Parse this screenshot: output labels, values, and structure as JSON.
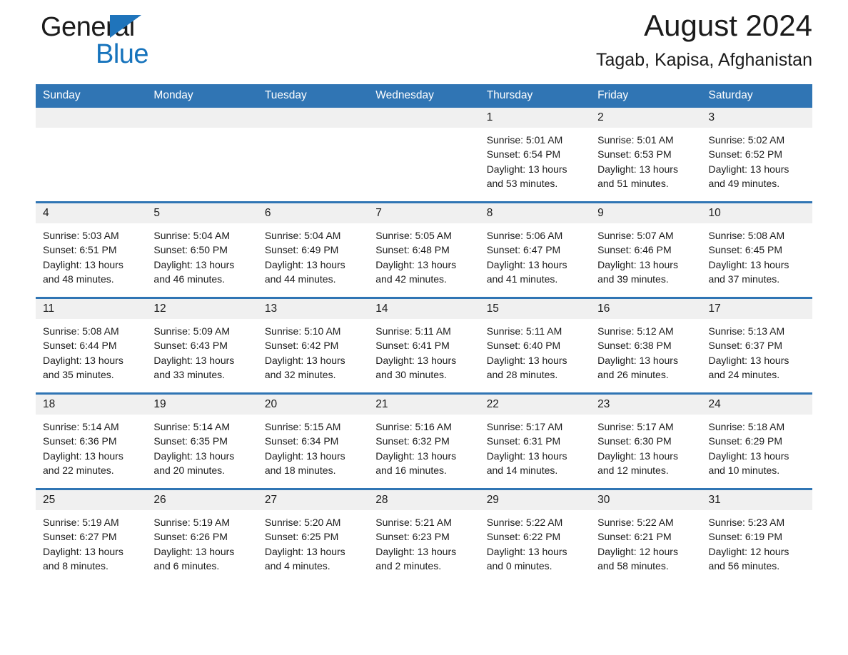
{
  "brand": {
    "name_part1": "General",
    "name_part2": "Blue",
    "triangle_color": "#1f74bb",
    "blue_color": "#1673bc"
  },
  "header": {
    "month_title": "August 2024",
    "location": "Tagab, Kapisa, Afghanistan",
    "accent_color": "#3075b4",
    "daynum_background": "#f0f0f0"
  },
  "weekday_headers": [
    "Sunday",
    "Monday",
    "Tuesday",
    "Wednesday",
    "Thursday",
    "Friday",
    "Saturday"
  ],
  "weeks": [
    [
      {
        "day": "",
        "sunrise": "",
        "sunset": "",
        "daylight": "",
        "empty": true
      },
      {
        "day": "",
        "sunrise": "",
        "sunset": "",
        "daylight": "",
        "empty": true
      },
      {
        "day": "",
        "sunrise": "",
        "sunset": "",
        "daylight": "",
        "empty": true
      },
      {
        "day": "",
        "sunrise": "",
        "sunset": "",
        "daylight": "",
        "empty": true
      },
      {
        "day": "1",
        "sunrise": "Sunrise: 5:01 AM",
        "sunset": "Sunset: 6:54 PM",
        "daylight": "Daylight: 13 hours and 53 minutes.",
        "empty": false
      },
      {
        "day": "2",
        "sunrise": "Sunrise: 5:01 AM",
        "sunset": "Sunset: 6:53 PM",
        "daylight": "Daylight: 13 hours and 51 minutes.",
        "empty": false
      },
      {
        "day": "3",
        "sunrise": "Sunrise: 5:02 AM",
        "sunset": "Sunset: 6:52 PM",
        "daylight": "Daylight: 13 hours and 49 minutes.",
        "empty": false
      }
    ],
    [
      {
        "day": "4",
        "sunrise": "Sunrise: 5:03 AM",
        "sunset": "Sunset: 6:51 PM",
        "daylight": "Daylight: 13 hours and 48 minutes.",
        "empty": false
      },
      {
        "day": "5",
        "sunrise": "Sunrise: 5:04 AM",
        "sunset": "Sunset: 6:50 PM",
        "daylight": "Daylight: 13 hours and 46 minutes.",
        "empty": false
      },
      {
        "day": "6",
        "sunrise": "Sunrise: 5:04 AM",
        "sunset": "Sunset: 6:49 PM",
        "daylight": "Daylight: 13 hours and 44 minutes.",
        "empty": false
      },
      {
        "day": "7",
        "sunrise": "Sunrise: 5:05 AM",
        "sunset": "Sunset: 6:48 PM",
        "daylight": "Daylight: 13 hours and 42 minutes.",
        "empty": false
      },
      {
        "day": "8",
        "sunrise": "Sunrise: 5:06 AM",
        "sunset": "Sunset: 6:47 PM",
        "daylight": "Daylight: 13 hours and 41 minutes.",
        "empty": false
      },
      {
        "day": "9",
        "sunrise": "Sunrise: 5:07 AM",
        "sunset": "Sunset: 6:46 PM",
        "daylight": "Daylight: 13 hours and 39 minutes.",
        "empty": false
      },
      {
        "day": "10",
        "sunrise": "Sunrise: 5:08 AM",
        "sunset": "Sunset: 6:45 PM",
        "daylight": "Daylight: 13 hours and 37 minutes.",
        "empty": false
      }
    ],
    [
      {
        "day": "11",
        "sunrise": "Sunrise: 5:08 AM",
        "sunset": "Sunset: 6:44 PM",
        "daylight": "Daylight: 13 hours and 35 minutes.",
        "empty": false
      },
      {
        "day": "12",
        "sunrise": "Sunrise: 5:09 AM",
        "sunset": "Sunset: 6:43 PM",
        "daylight": "Daylight: 13 hours and 33 minutes.",
        "empty": false
      },
      {
        "day": "13",
        "sunrise": "Sunrise: 5:10 AM",
        "sunset": "Sunset: 6:42 PM",
        "daylight": "Daylight: 13 hours and 32 minutes.",
        "empty": false
      },
      {
        "day": "14",
        "sunrise": "Sunrise: 5:11 AM",
        "sunset": "Sunset: 6:41 PM",
        "daylight": "Daylight: 13 hours and 30 minutes.",
        "empty": false
      },
      {
        "day": "15",
        "sunrise": "Sunrise: 5:11 AM",
        "sunset": "Sunset: 6:40 PM",
        "daylight": "Daylight: 13 hours and 28 minutes.",
        "empty": false
      },
      {
        "day": "16",
        "sunrise": "Sunrise: 5:12 AM",
        "sunset": "Sunset: 6:38 PM",
        "daylight": "Daylight: 13 hours and 26 minutes.",
        "empty": false
      },
      {
        "day": "17",
        "sunrise": "Sunrise: 5:13 AM",
        "sunset": "Sunset: 6:37 PM",
        "daylight": "Daylight: 13 hours and 24 minutes.",
        "empty": false
      }
    ],
    [
      {
        "day": "18",
        "sunrise": "Sunrise: 5:14 AM",
        "sunset": "Sunset: 6:36 PM",
        "daylight": "Daylight: 13 hours and 22 minutes.",
        "empty": false
      },
      {
        "day": "19",
        "sunrise": "Sunrise: 5:14 AM",
        "sunset": "Sunset: 6:35 PM",
        "daylight": "Daylight: 13 hours and 20 minutes.",
        "empty": false
      },
      {
        "day": "20",
        "sunrise": "Sunrise: 5:15 AM",
        "sunset": "Sunset: 6:34 PM",
        "daylight": "Daylight: 13 hours and 18 minutes.",
        "empty": false
      },
      {
        "day": "21",
        "sunrise": "Sunrise: 5:16 AM",
        "sunset": "Sunset: 6:32 PM",
        "daylight": "Daylight: 13 hours and 16 minutes.",
        "empty": false
      },
      {
        "day": "22",
        "sunrise": "Sunrise: 5:17 AM",
        "sunset": "Sunset: 6:31 PM",
        "daylight": "Daylight: 13 hours and 14 minutes.",
        "empty": false
      },
      {
        "day": "23",
        "sunrise": "Sunrise: 5:17 AM",
        "sunset": "Sunset: 6:30 PM",
        "daylight": "Daylight: 13 hours and 12 minutes.",
        "empty": false
      },
      {
        "day": "24",
        "sunrise": "Sunrise: 5:18 AM",
        "sunset": "Sunset: 6:29 PM",
        "daylight": "Daylight: 13 hours and 10 minutes.",
        "empty": false
      }
    ],
    [
      {
        "day": "25",
        "sunrise": "Sunrise: 5:19 AM",
        "sunset": "Sunset: 6:27 PM",
        "daylight": "Daylight: 13 hours and 8 minutes.",
        "empty": false
      },
      {
        "day": "26",
        "sunrise": "Sunrise: 5:19 AM",
        "sunset": "Sunset: 6:26 PM",
        "daylight": "Daylight: 13 hours and 6 minutes.",
        "empty": false
      },
      {
        "day": "27",
        "sunrise": "Sunrise: 5:20 AM",
        "sunset": "Sunset: 6:25 PM",
        "daylight": "Daylight: 13 hours and 4 minutes.",
        "empty": false
      },
      {
        "day": "28",
        "sunrise": "Sunrise: 5:21 AM",
        "sunset": "Sunset: 6:23 PM",
        "daylight": "Daylight: 13 hours and 2 minutes.",
        "empty": false
      },
      {
        "day": "29",
        "sunrise": "Sunrise: 5:22 AM",
        "sunset": "Sunset: 6:22 PM",
        "daylight": "Daylight: 13 hours and 0 minutes.",
        "empty": false
      },
      {
        "day": "30",
        "sunrise": "Sunrise: 5:22 AM",
        "sunset": "Sunset: 6:21 PM",
        "daylight": "Daylight: 12 hours and 58 minutes.",
        "empty": false
      },
      {
        "day": "31",
        "sunrise": "Sunrise: 5:23 AM",
        "sunset": "Sunset: 6:19 PM",
        "daylight": "Daylight: 12 hours and 56 minutes.",
        "empty": false
      }
    ]
  ]
}
